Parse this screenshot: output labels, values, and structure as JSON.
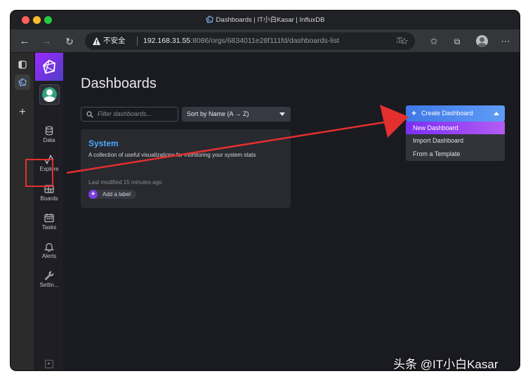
{
  "window": {
    "title": "Dashboards | IT小白Kasar | InfluxDB"
  },
  "browser": {
    "insecure_label": "不安全",
    "url_host": "192.168.31.55",
    "url_rest": ":8086/orgs/6834011e28f111fd/dashboards-list"
  },
  "nav": {
    "items": [
      {
        "label": "Data",
        "icon": "database-icon"
      },
      {
        "label": "Explore",
        "icon": "explore-icon"
      },
      {
        "label": "Boards",
        "icon": "boards-icon"
      },
      {
        "label": "Tasks",
        "icon": "calendar-icon"
      },
      {
        "label": "Alerts",
        "icon": "bell-icon"
      },
      {
        "label": "Settin...",
        "icon": "wrench-icon"
      }
    ]
  },
  "page": {
    "title": "Dashboards",
    "filter_placeholder": "Filter dashboards...",
    "sort_label": "Sort by Name (A → Z)",
    "create_button": "Create Dashboard",
    "create_menu": [
      "New Dashboard",
      "Import Dashboard",
      "From a Template"
    ],
    "active_menu_index": 0
  },
  "dashboard_card": {
    "title": "System",
    "description": "A collection of useful visualizations for monitoring your system stats",
    "last_modified": "Last modified 15 minutes ago",
    "add_label": "Add a label"
  },
  "colors": {
    "accent_blue": "#4ba9ff",
    "accent_purple": "#7b2ff3",
    "annotation_red": "#e3302f"
  },
  "watermark": "头条 @IT小白Kasar"
}
